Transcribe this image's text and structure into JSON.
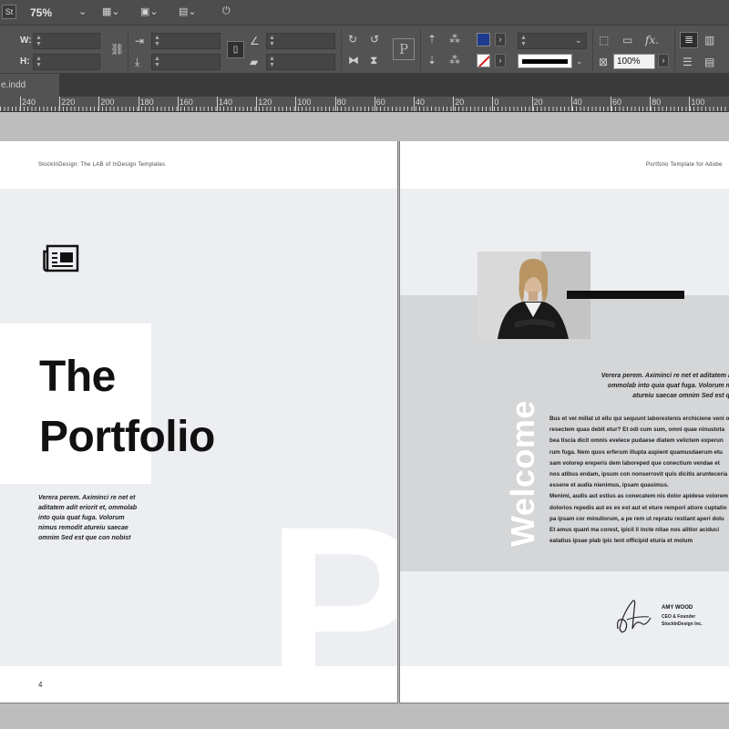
{
  "app": {
    "logo": "St",
    "zoom": "75%"
  },
  "control": {
    "w_label": "W:",
    "h_label": "H:",
    "pct_value": "100%",
    "fx": "fx.",
    "p_button": "P"
  },
  "tab": {
    "label": "e.indd"
  },
  "ruler": {
    "labels": [
      "240",
      "220",
      "200",
      "180",
      "160",
      "140",
      "120",
      "100",
      "80",
      "60",
      "40",
      "20",
      "0",
      "20",
      "40",
      "60",
      "80",
      "100"
    ]
  },
  "left_page": {
    "header": "StockInDesign: The LAB of InDesign Templates",
    "title_line1": "The",
    "title_line2": "Portfolio",
    "intro": "Verera perem. Aximinci re net et aditatem adit eriorit et, ommolab into quia quat fuga. Volorum nimus remodit atureiu saecae omnim Sed est que con nobist",
    "big_letter": "P",
    "page_number": "4"
  },
  "right_page": {
    "header": "Portfolio Template for Adobe",
    "welcome": "Welcome",
    "quote_lines": [
      "Verera perem. Aximinci re net et aditatem adi",
      "ommolab into quia quat fuga. Volorum nim",
      "atureiu saecae omnim Sed est que"
    ],
    "body_lines": [
      "Bus et vel millat ut ellu qui sequunt laborestenis erchiciene veni o",
      "resectem quas debit etur? Et odi cum sum, omni quae ninustota",
      "bea tiscia dicit omnis evelece pudaese diatem velictem experun",
      "rum fuga. Nem quos erferum illupta aspient quamusdaerum etu",
      "sam volorep ereperis dem laboreped que conectium vendae et",
      "nos atibus endam, ipsum con nonserrovit quis dicitis arunteceria p",
      "essene et audia nienimus, ipsam quasimus.",
      "Menimi, audis aut estius as conecatem nis dolor apidese volorem",
      "dolorios repedis aut ex ex est aut et eture rempori atiore cuptatio",
      "pa ipsam cor minullorum, a pe rem ut repratu restiant aperi dolu",
      "Et amus quant ma corest, ipicil il incte nitae nos alitior aciduci",
      "eatatius ipsae plab ipic tent officipid eturia et molum"
    ],
    "signer_name": "AMY WOOD",
    "signer_role1": "CEO & Founder",
    "signer_role2": "StockInDesign Inc."
  },
  "colors": {
    "fill_swatch": "#1f3b8f",
    "stroke_swatch": "#d02020"
  }
}
